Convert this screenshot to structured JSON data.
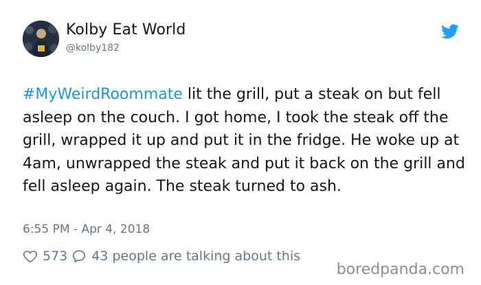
{
  "author": {
    "name": "Kolby Eat World",
    "handle": "@kolby182"
  },
  "icons": {
    "platform": "twitter-bird-icon",
    "like": "heart-outline-icon",
    "reply": "speech-bubble-icon"
  },
  "colors": {
    "brand": "#1da1f2",
    "hashtag": "#1b95e0",
    "text": "#14171a",
    "muted": "#657786",
    "watermark": "#8e8e8e"
  },
  "tweet": {
    "hashtag": "#MyWeirdRoommate",
    "text": " lit the grill, put a steak on but fell asleep on the couch. I got home, I took the steak off the grill, wrapped it up and put it in the fridge. He woke up at 4am, unwrapped the steak and put it back on the grill and fell asleep again. The steak turned to ash.",
    "timestamp": "6:55 PM - Apr 4, 2018"
  },
  "engagement": {
    "likes": "573",
    "talking": "43 people are talking about this"
  },
  "watermark": "boredpanda.com"
}
